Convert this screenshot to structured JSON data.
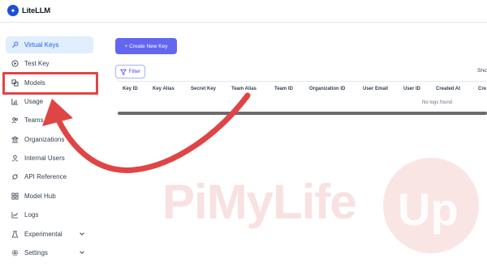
{
  "app": {
    "name": "LiteLLM"
  },
  "sidebar": {
    "items": [
      {
        "label": "Virtual Keys",
        "icon": "key-icon"
      },
      {
        "label": "Test Key",
        "icon": "play-circle-icon"
      },
      {
        "label": "Models",
        "icon": "cube-icon"
      },
      {
        "label": "Usage",
        "icon": "bar-chart-icon"
      },
      {
        "label": "Teams",
        "icon": "team-icon"
      },
      {
        "label": "Organizations",
        "icon": "bank-icon"
      },
      {
        "label": "Internal Users",
        "icon": "user-icon"
      },
      {
        "label": "API Reference",
        "icon": "api-icon"
      },
      {
        "label": "Model Hub",
        "icon": "grid-icon"
      },
      {
        "label": "Logs",
        "icon": "line-chart-icon"
      },
      {
        "label": "Experimental",
        "icon": "experiment-icon"
      },
      {
        "label": "Settings",
        "icon": "settings-icon"
      }
    ]
  },
  "main": {
    "create_button": "+ Create New Key",
    "filter_button": "Filter",
    "show_text": "Sho",
    "table": {
      "columns": [
        "Key ID",
        "Key Alias",
        "Secret Key",
        "Team Alias",
        "Team ID",
        "Organization ID",
        "User Email",
        "User ID",
        "Created At",
        "Cre"
      ],
      "empty_text": "No logs found"
    }
  },
  "watermark": {
    "text": "PiMyLife",
    "badge": "Up"
  },
  "colors": {
    "accent": "#6366f1",
    "active_bg": "#e0eefe",
    "annotation": "#e04545",
    "watermark": "#f3c9c9"
  }
}
